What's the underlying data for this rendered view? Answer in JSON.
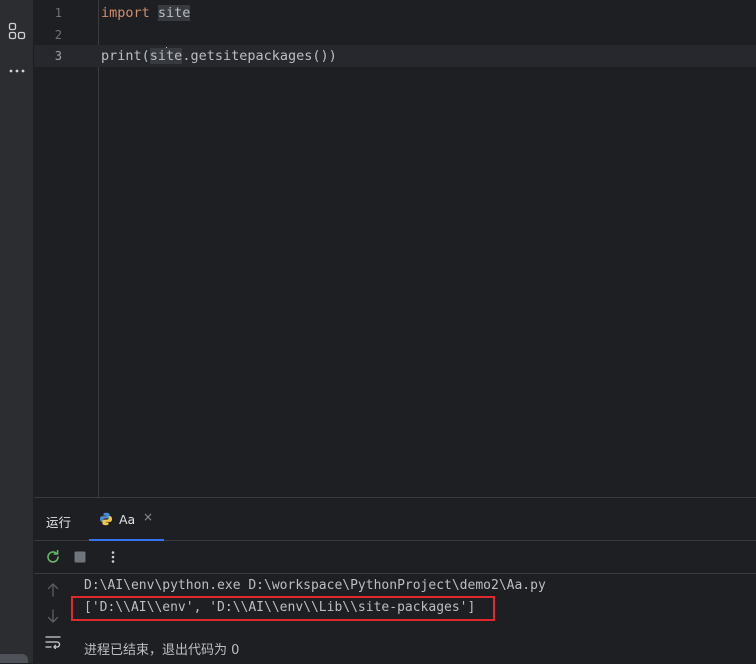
{
  "left_toolbar": {
    "icons": [
      "structure-icon",
      "more-icon"
    ]
  },
  "editor": {
    "lines": [
      {
        "number": "1",
        "keyword": "import",
        "rest": " site"
      },
      {
        "number": "2"
      },
      {
        "number": "3",
        "prefix": "print(",
        "hl_a": "si",
        "hl_b": "te",
        "suffix": ".getsitepackages())"
      }
    ]
  },
  "run_panel": {
    "title": "运行",
    "tab": {
      "label": "Aa",
      "close": "×"
    },
    "console": {
      "command": "D:\\AI\\env\\python.exe D:\\workspace\\PythonProject\\demo2\\Aa.py",
      "output": "['D:\\\\AI\\\\env', 'D:\\\\AI\\\\env\\\\Lib\\\\site-packages']",
      "exit_message": "进程已结束，退出代码为 0"
    }
  },
  "colors": {
    "keyword": "#cf8e6d",
    "text": "#bcbec4",
    "highlight_box": "#e0282e",
    "tab_underline": "#3574f0"
  }
}
